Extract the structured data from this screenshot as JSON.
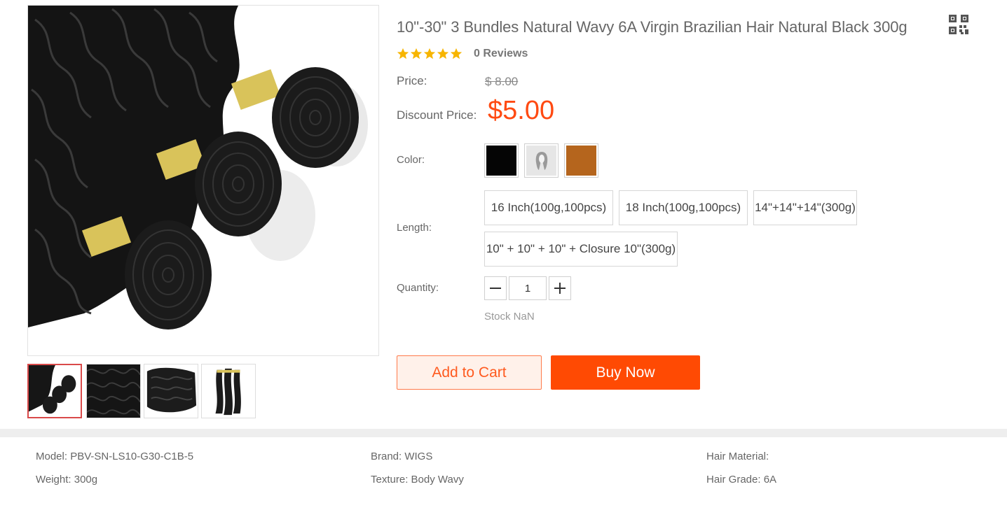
{
  "product": {
    "title": "10\"-30\" 3 Bundles Natural Wavy 6A Virgin Brazilian Hair Natural Black 300g",
    "rating_stars": 5,
    "reviews": "0 Reviews",
    "price_label": "Price:",
    "old_price": "$ 8.00",
    "discount_label": "Discount Price:",
    "discount_price": "$5.00",
    "color_label": "Color:",
    "colors": [
      {
        "name": "black",
        "hex": "#050505"
      },
      {
        "name": "gray-image",
        "hex": "#e6e6e6"
      },
      {
        "name": "brown",
        "hex": "#b5651d"
      }
    ],
    "length_label": "Length:",
    "lengths": [
      "16 Inch(100g,100pcs)",
      "18 Inch(100g,100pcs)",
      "14\"+14\"+14\"(300g)",
      "10\" + 10\" + 10\" + Closure 10\"(300g)"
    ],
    "quantity_label": "Quantity:",
    "quantity": "1",
    "stock": "Stock NaN",
    "add_to_cart": "Add to Cart",
    "buy_now": "Buy Now"
  },
  "specs": {
    "model": "Model: PBV-SN-LS10-G30-C1B-5",
    "brand": "Brand: WIGS",
    "hair_material": "Hair Material:",
    "weight": "Weight: 300g",
    "texture": "Texture: Body Wavy",
    "hair_grade": "Hair Grade: 6A"
  },
  "icons": {
    "qr": "qr-code-icon",
    "star": "star-icon",
    "minus": "minus-icon",
    "plus": "plus-icon"
  },
  "colors": {
    "accent": "#ff4a03",
    "price": "#ff4a12",
    "star": "#f7b500",
    "thumb_active_border": "#d94a4a"
  }
}
